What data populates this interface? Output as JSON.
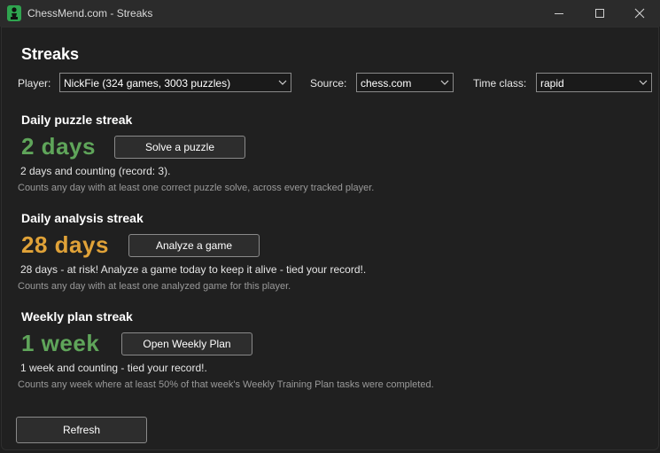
{
  "window": {
    "title": "ChessMend.com - Streaks"
  },
  "page": {
    "heading": "Streaks"
  },
  "filters": {
    "player_label": "Player:",
    "player_value": "NickFie (324 games, 3003 puzzles)",
    "source_label": "Source:",
    "source_value": "chess.com",
    "timeclass_label": "Time class:",
    "timeclass_value": "rapid"
  },
  "streaks": {
    "puzzle": {
      "title": "Daily puzzle streak",
      "value": "2 days",
      "button": "Solve a puzzle",
      "status": "2 days and counting (record: 3).",
      "hint": "Counts any day with at least one correct puzzle solve, across every tracked player."
    },
    "analysis": {
      "title": "Daily analysis streak",
      "value": "28 days",
      "button": "Analyze a game",
      "status": "28 days - at risk! Analyze a game today to keep it alive - tied your record!.",
      "hint": "Counts any day with at least one analyzed game for this player."
    },
    "weekly": {
      "title": "Weekly plan streak",
      "value": "1 week",
      "button": "Open Weekly Plan",
      "status": "1 week and counting - tied your record!.",
      "hint": "Counts any week where at least 50% of that week's Weekly Training Plan tasks were completed."
    }
  },
  "footer": {
    "refresh": "Refresh"
  },
  "colors": {
    "ok_green": "#5fa55a",
    "at_risk_amber": "#e0a238",
    "background": "#202020",
    "titlebar": "#2b2b2b"
  },
  "icons": {
    "app": "chess-pawn-icon",
    "minimize": "minimize-icon",
    "maximize": "maximize-icon",
    "close": "close-icon",
    "dropdown": "chevron-down-icon"
  }
}
